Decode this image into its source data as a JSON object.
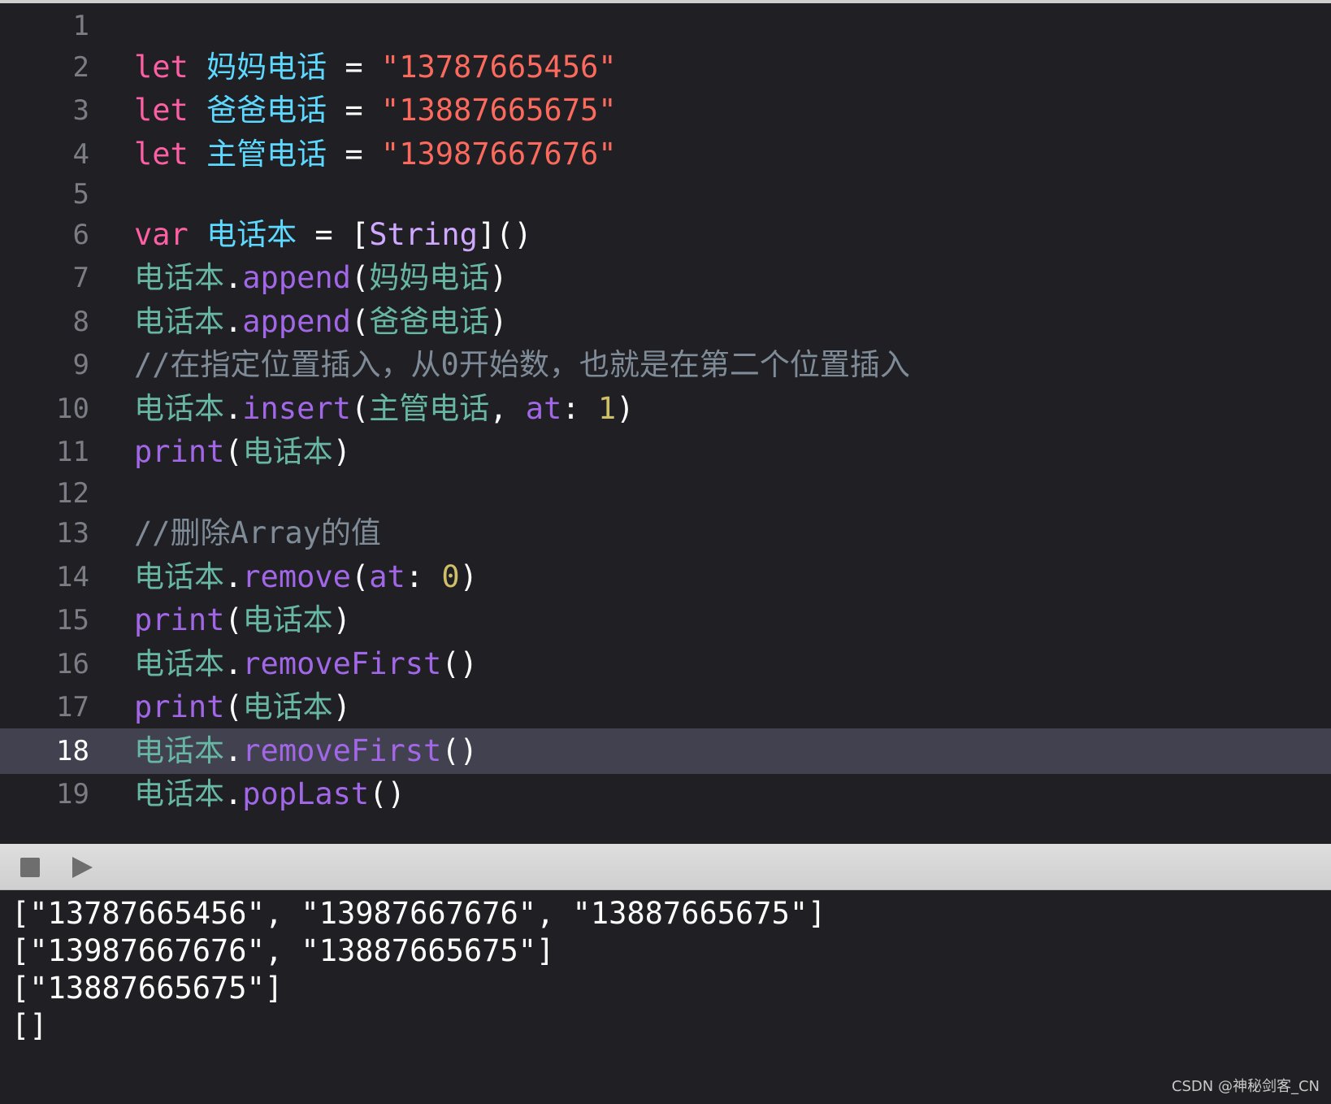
{
  "editor": {
    "current_line": "18",
    "lines": [
      {
        "num": "1",
        "tokens": []
      },
      {
        "num": "2",
        "tokens": [
          {
            "t": "let",
            "c": "kw"
          },
          {
            "t": " ",
            "c": "pl"
          },
          {
            "t": "妈妈电话",
            "c": "decl"
          },
          {
            "t": " = ",
            "c": "pl"
          },
          {
            "t": "\"13787665456\"",
            "c": "str"
          }
        ]
      },
      {
        "num": "3",
        "tokens": [
          {
            "t": "let",
            "c": "kw"
          },
          {
            "t": " ",
            "c": "pl"
          },
          {
            "t": "爸爸电话",
            "c": "decl"
          },
          {
            "t": " = ",
            "c": "pl"
          },
          {
            "t": "\"13887665675\"",
            "c": "str"
          }
        ]
      },
      {
        "num": "4",
        "tokens": [
          {
            "t": "let",
            "c": "kw"
          },
          {
            "t": " ",
            "c": "pl"
          },
          {
            "t": "主管电话",
            "c": "decl"
          },
          {
            "t": " = ",
            "c": "pl"
          },
          {
            "t": "\"13987667676\"",
            "c": "str"
          }
        ]
      },
      {
        "num": "5",
        "tokens": []
      },
      {
        "num": "6",
        "tokens": [
          {
            "t": "var",
            "c": "kw"
          },
          {
            "t": " ",
            "c": "pl"
          },
          {
            "t": "电话本",
            "c": "decl"
          },
          {
            "t": " = [",
            "c": "pl"
          },
          {
            "t": "String",
            "c": "typ"
          },
          {
            "t": "]()",
            "c": "pl"
          }
        ]
      },
      {
        "num": "7",
        "tokens": [
          {
            "t": "电话本",
            "c": "id"
          },
          {
            "t": ".",
            "c": "pl"
          },
          {
            "t": "append",
            "c": "fn"
          },
          {
            "t": "(",
            "c": "pl"
          },
          {
            "t": "妈妈电话",
            "c": "id"
          },
          {
            "t": ")",
            "c": "pl"
          }
        ]
      },
      {
        "num": "8",
        "tokens": [
          {
            "t": "电话本",
            "c": "id"
          },
          {
            "t": ".",
            "c": "pl"
          },
          {
            "t": "append",
            "c": "fn"
          },
          {
            "t": "(",
            "c": "pl"
          },
          {
            "t": "爸爸电话",
            "c": "id"
          },
          {
            "t": ")",
            "c": "pl"
          }
        ]
      },
      {
        "num": "9",
        "tokens": [
          {
            "t": "//在指定位置插入，从0开始数，也就是在第二个位置插入",
            "c": "cmt"
          }
        ]
      },
      {
        "num": "10",
        "tokens": [
          {
            "t": "电话本",
            "c": "id"
          },
          {
            "t": ".",
            "c": "pl"
          },
          {
            "t": "insert",
            "c": "fn"
          },
          {
            "t": "(",
            "c": "pl"
          },
          {
            "t": "主管电话",
            "c": "id"
          },
          {
            "t": ", ",
            "c": "pl"
          },
          {
            "t": "at",
            "c": "fn"
          },
          {
            "t": ": ",
            "c": "pl"
          },
          {
            "t": "1",
            "c": "num"
          },
          {
            "t": ")",
            "c": "pl"
          }
        ]
      },
      {
        "num": "11",
        "tokens": [
          {
            "t": "print",
            "c": "fn"
          },
          {
            "t": "(",
            "c": "pl"
          },
          {
            "t": "电话本",
            "c": "id"
          },
          {
            "t": ")",
            "c": "pl"
          }
        ]
      },
      {
        "num": "12",
        "tokens": []
      },
      {
        "num": "13",
        "tokens": [
          {
            "t": "//删除Array的值",
            "c": "cmt"
          }
        ]
      },
      {
        "num": "14",
        "tokens": [
          {
            "t": "电话本",
            "c": "id"
          },
          {
            "t": ".",
            "c": "pl"
          },
          {
            "t": "remove",
            "c": "fn"
          },
          {
            "t": "(",
            "c": "pl"
          },
          {
            "t": "at",
            "c": "fn"
          },
          {
            "t": ": ",
            "c": "pl"
          },
          {
            "t": "0",
            "c": "num"
          },
          {
            "t": ")",
            "c": "pl"
          }
        ]
      },
      {
        "num": "15",
        "tokens": [
          {
            "t": "print",
            "c": "fn"
          },
          {
            "t": "(",
            "c": "pl"
          },
          {
            "t": "电话本",
            "c": "id"
          },
          {
            "t": ")",
            "c": "pl"
          }
        ]
      },
      {
        "num": "16",
        "tokens": [
          {
            "t": "电话本",
            "c": "id"
          },
          {
            "t": ".",
            "c": "pl"
          },
          {
            "t": "removeFirst",
            "c": "fn"
          },
          {
            "t": "()",
            "c": "pl"
          }
        ]
      },
      {
        "num": "17",
        "tokens": [
          {
            "t": "print",
            "c": "fn"
          },
          {
            "t": "(",
            "c": "pl"
          },
          {
            "t": "电话本",
            "c": "id"
          },
          {
            "t": ")",
            "c": "pl"
          }
        ]
      },
      {
        "num": "18",
        "tokens": [
          {
            "t": "电话本",
            "c": "id"
          },
          {
            "t": ".",
            "c": "pl"
          },
          {
            "t": "removeFirst",
            "c": "fn"
          },
          {
            "t": "()",
            "c": "pl"
          }
        ]
      },
      {
        "num": "19",
        "tokens": [
          {
            "t": "电话本",
            "c": "id"
          },
          {
            "t": ".",
            "c": "pl"
          },
          {
            "t": "popLast",
            "c": "fn"
          },
          {
            "t": "()",
            "c": "pl"
          }
        ]
      }
    ]
  },
  "debug_bar": {
    "stop_icon": "stop-square-icon",
    "run_icon": "play-triangle-icon"
  },
  "console": {
    "lines": [
      "[\"13787665456\", \"13987667676\", \"13887665675\"]",
      "[\"13987667676\", \"13887665675\"]",
      "[\"13887665675\"]",
      "[]"
    ]
  },
  "watermark": "CSDN @神秘剑客_CN",
  "colors": {
    "background": "#1f1f24",
    "current_line": "#41414f",
    "keyword": "#fc5fa3",
    "declaration": "#5dd8ff",
    "string": "#fc6a5d",
    "identifier": "#67b7a4",
    "function": "#a167e6",
    "number": "#d0bf69",
    "comment": "#7f8c98"
  }
}
